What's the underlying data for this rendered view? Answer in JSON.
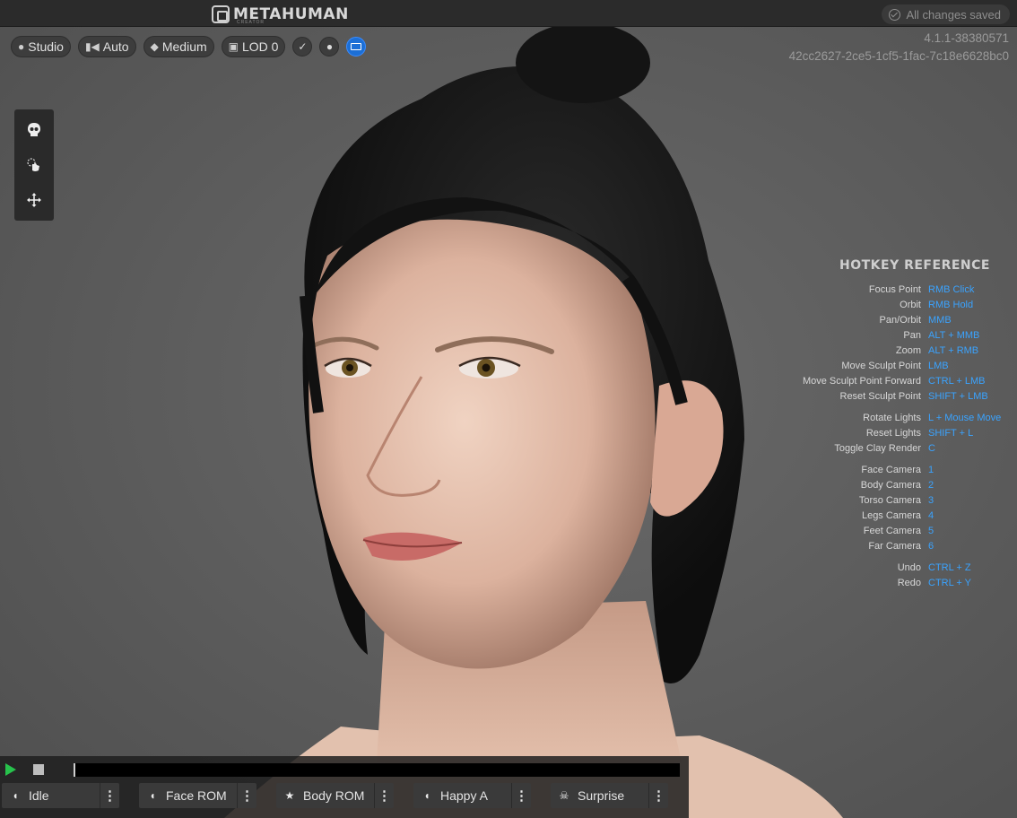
{
  "app": {
    "logo_text": "METAHUMAN",
    "logo_subtext": "CREATOR",
    "save_status": "All changes saved"
  },
  "toolbar": {
    "lighting_label": "Studio",
    "camera_label": "Auto",
    "quality_label": "Medium",
    "lod_label": "LOD 0"
  },
  "build_info": {
    "version": "4.1.1-38380571",
    "id": "42cc2627-2ce5-1cf5-1fac-7c18e6628bc0"
  },
  "hotkeys": {
    "title": "HOTKEY REFERENCE",
    "groups": [
      [
        {
          "label": "Focus Point",
          "key": "RMB Click"
        },
        {
          "label": "Orbit",
          "key": "RMB Hold"
        },
        {
          "label": "Pan/Orbit",
          "key": "MMB"
        },
        {
          "label": "Pan",
          "key": "ALT + MMB"
        },
        {
          "label": "Zoom",
          "key": "ALT + RMB"
        },
        {
          "label": "Move Sculpt Point",
          "key": "LMB"
        },
        {
          "label": "Move Sculpt Point Forward",
          "key": "CTRL + LMB"
        },
        {
          "label": "Reset Sculpt Point",
          "key": "SHIFT + LMB"
        }
      ],
      [
        {
          "label": "Rotate Lights",
          "key": "L + Mouse Move"
        },
        {
          "label": "Reset Lights",
          "key": "SHIFT + L"
        },
        {
          "label": "Toggle Clay Render",
          "key": "C"
        }
      ],
      [
        {
          "label": "Face Camera",
          "key": "1"
        },
        {
          "label": "Body Camera",
          "key": "2"
        },
        {
          "label": "Torso Camera",
          "key": "3"
        },
        {
          "label": "Legs Camera",
          "key": "4"
        },
        {
          "label": "Feet Camera",
          "key": "5"
        },
        {
          "label": "Far Camera",
          "key": "6"
        }
      ],
      [
        {
          "label": "Undo",
          "key": "CTRL + Z"
        },
        {
          "label": "Redo",
          "key": "CTRL + Y"
        }
      ]
    ]
  },
  "animations": [
    {
      "label": "Idle",
      "icon": "face-icon"
    },
    {
      "label": "Face ROM",
      "icon": "face-icon"
    },
    {
      "label": "Body ROM",
      "icon": "running-figure-icon"
    },
    {
      "label": "Happy A",
      "icon": "face-icon"
    },
    {
      "label": "Surprise",
      "icon": "skull-icon"
    }
  ],
  "colors": {
    "accent": "#3aa3ff",
    "play": "#27c24c",
    "active_toggle": "#1c6fd6"
  }
}
